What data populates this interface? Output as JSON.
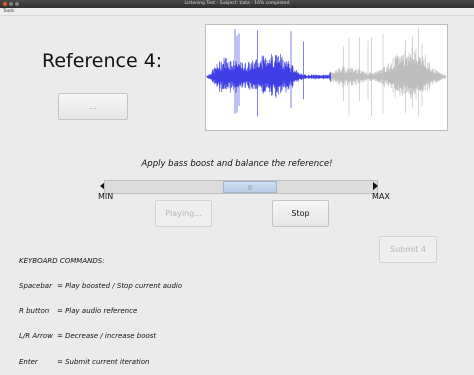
{
  "window": {
    "title": "Listening Test - Subject: tiata - 16% completed",
    "dot_colors": [
      "#e95420",
      "#7f7f7f",
      "#7f7f7f"
    ]
  },
  "menubar": {
    "items": [
      "Tools"
    ]
  },
  "reference": {
    "label": "Reference 4:",
    "play_button_label": "..."
  },
  "waveform": {
    "played_color": "#0000dd",
    "unplayed_color": "#a9a9a9",
    "played_fraction": 0.52
  },
  "instruction": "Apply bass boost and balance the reference!",
  "slider": {
    "min_label": "MIN",
    "max_label": "MAX",
    "value_fraction": 0.54
  },
  "buttons": {
    "playing_label": "Playing...",
    "stop_label": "Stop",
    "submit_label": "Submit 4"
  },
  "keyboard": {
    "heading": "KEYBOARD COMMANDS:",
    "commands": [
      {
        "key": "Spacebar",
        "desc": "= Play boosted / Stop current audio"
      },
      {
        "key": "R button",
        "desc": "= Play audio reference"
      },
      {
        "key": "L/R Arrow",
        "desc": "= Decrease / increase boost"
      },
      {
        "key": "Enter",
        "desc": "= Submit current iteration"
      }
    ]
  }
}
